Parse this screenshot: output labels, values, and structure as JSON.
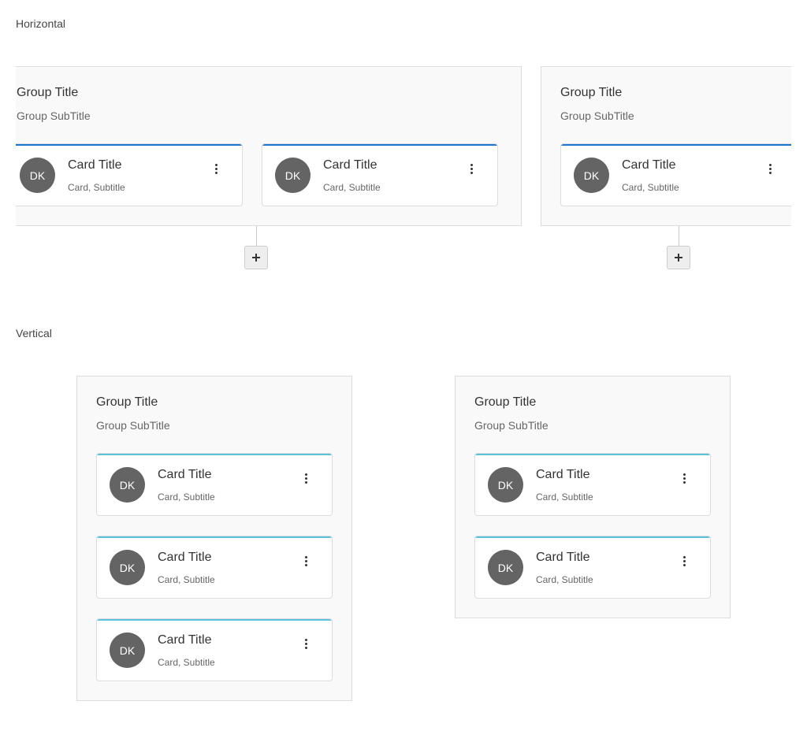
{
  "colors": {
    "horizontal_accent": "#1976d2",
    "vertical_accent": "#5bc0de"
  },
  "sections": {
    "horizontal": {
      "label": "Horizontal"
    },
    "vertical": {
      "label": "Vertical"
    }
  },
  "horizontal_groups": [
    {
      "title": "Group Title",
      "subtitle": "Group SubTitle",
      "add_icon": "plus-icon",
      "cards": [
        {
          "initials": "DK",
          "title": "Card Title",
          "subtitle": "Card, Subtitle",
          "menu_icon": "more-vertical-icon"
        },
        {
          "initials": "DK",
          "title": "Card Title",
          "subtitle": "Card, Subtitle",
          "menu_icon": "more-vertical-icon"
        }
      ]
    },
    {
      "title": "Group Title",
      "subtitle": "Group SubTitle",
      "add_icon": "plus-icon",
      "cards": [
        {
          "initials": "DK",
          "title": "Card Title",
          "subtitle": "Card, Subtitle",
          "menu_icon": "more-vertical-icon"
        }
      ]
    }
  ],
  "vertical_groups": [
    {
      "title": "Group Title",
      "subtitle": "Group SubTitle",
      "cards": [
        {
          "initials": "DK",
          "title": "Card Title",
          "subtitle": "Card, Subtitle",
          "menu_icon": "more-vertical-icon"
        },
        {
          "initials": "DK",
          "title": "Card Title",
          "subtitle": "Card, Subtitle",
          "menu_icon": "more-vertical-icon"
        },
        {
          "initials": "DK",
          "title": "Card Title",
          "subtitle": "Card, Subtitle",
          "menu_icon": "more-vertical-icon"
        }
      ]
    },
    {
      "title": "Group Title",
      "subtitle": "Group SubTitle",
      "cards": [
        {
          "initials": "DK",
          "title": "Card Title",
          "subtitle": "Card, Subtitle",
          "menu_icon": "more-vertical-icon"
        },
        {
          "initials": "DK",
          "title": "Card Title",
          "subtitle": "Card, Subtitle",
          "menu_icon": "more-vertical-icon"
        }
      ]
    }
  ]
}
